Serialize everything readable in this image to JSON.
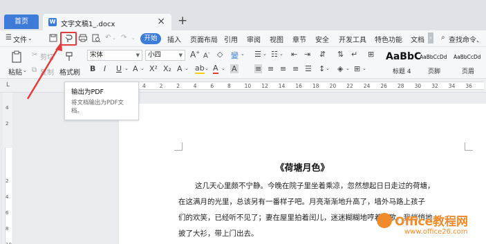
{
  "tabs": {
    "home": "首页",
    "document": "文字文稿1_.docx",
    "close": "×",
    "new_tab": "+"
  },
  "menu": {
    "file": "文件",
    "start": "开始",
    "insert": "插入",
    "layout": "页面布局",
    "reference": "引用",
    "review": "审阅",
    "view": "视图",
    "chapter": "章节",
    "security": "安全",
    "dev_tools": "开发工具",
    "special": "特色功能",
    "docs": "文档",
    "search": "查找命令、"
  },
  "ribbon": {
    "cut": "剪切",
    "paste": "粘贴",
    "copy": "复制",
    "format_painter": "格式刷",
    "font_name": "宋体",
    "font_size": "小四",
    "style_normal_big": "AaBbC",
    "style_heading4_name": "标题 4",
    "style_footer_sample": "AaBbCcDd",
    "style_footer_name": "页脚",
    "style_header_sample": "AaBbCcDd",
    "style_header_name": "页眉"
  },
  "ruler_numbers": [
    "4",
    "2",
    "2",
    "4",
    "6",
    "8",
    "10",
    "12",
    "14",
    "16",
    "18",
    "20",
    "22",
    "24",
    "26",
    "28",
    "30",
    "32",
    "34",
    "36"
  ],
  "vruler_numbers": [
    "4",
    "2",
    "2",
    "4",
    "6",
    "8",
    "10"
  ],
  "tooltip": {
    "title": "输出为PDF",
    "description": "将文档输出为PDF文档。"
  },
  "document": {
    "title": "《荷塘月色》",
    "lines": [
      "这几天心里颇不宁静。今晚在院子里坐着乘凉，忽然想起日日走过的荷塘，",
      "在这满月的光里，总该另有一番样子吧。月亮渐渐地升高了，墙外马路上孩子",
      "们的欢笑，已经听不见了；妻在屋里拍着闰儿，迷迷糊糊地哼着眠歌。我悄悄地",
      "披了大衫，带上门出去。"
    ]
  },
  "watermark": {
    "main": "Office教程网",
    "url": "www.office26.com"
  },
  "colors": {
    "accent": "#3d7bd9",
    "highlight": "#e33b3b",
    "watermark": "#f08a2b"
  }
}
